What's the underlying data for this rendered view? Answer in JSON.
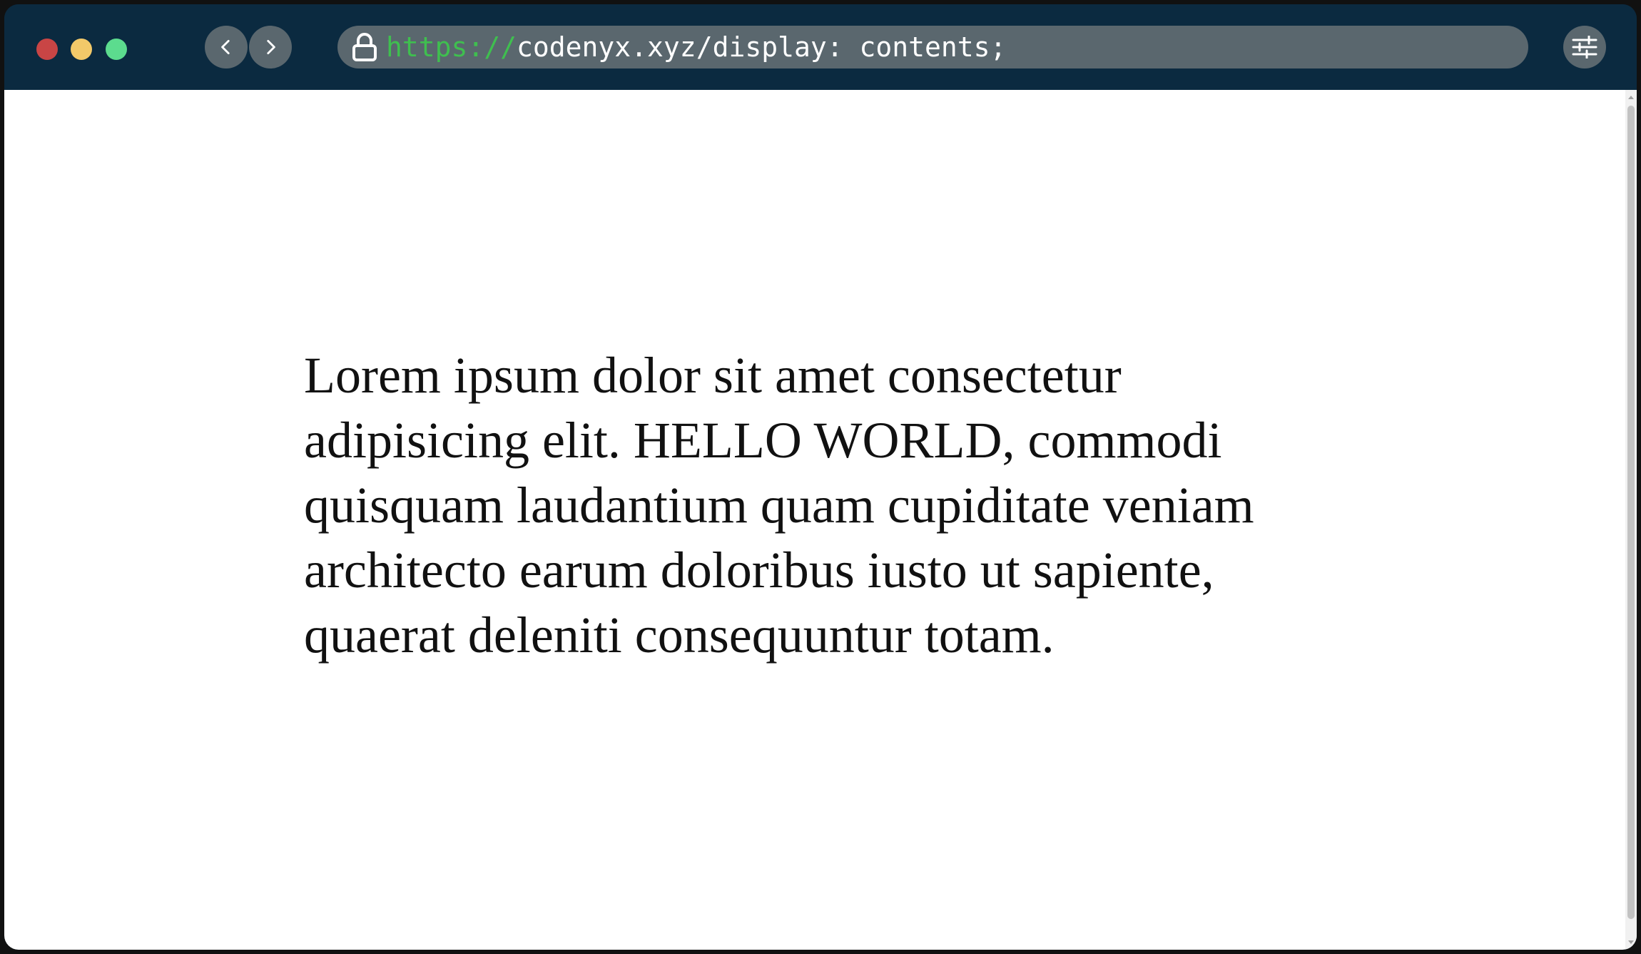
{
  "window": {
    "traffic_lights": [
      {
        "name": "close",
        "color": "#c94545"
      },
      {
        "name": "minimize",
        "color": "#f3c969"
      },
      {
        "name": "zoom",
        "color": "#5cdc8e"
      }
    ]
  },
  "toolbar": {
    "back_icon": "chevron-left-icon",
    "forward_icon": "chevron-right-icon",
    "settings_icon": "sliders-icon"
  },
  "address_bar": {
    "lock_icon": "lock-icon",
    "scheme": "https://",
    "path": "codenyx.xyz/display: contents;",
    "scheme_color": "#3fbf4f"
  },
  "page": {
    "paragraph": "Lorem ipsum dolor sit amet consectetur adipisicing elit. HELLO WORLD, commodi quisquam laudantium quam cupiditate veniam architecto earum doloribus iusto ut sapiente, quaerat deleniti consequuntur totam."
  },
  "colors": {
    "titlebar": "#0b2a40",
    "control": "#5a676e",
    "viewport": "#ffffff"
  }
}
